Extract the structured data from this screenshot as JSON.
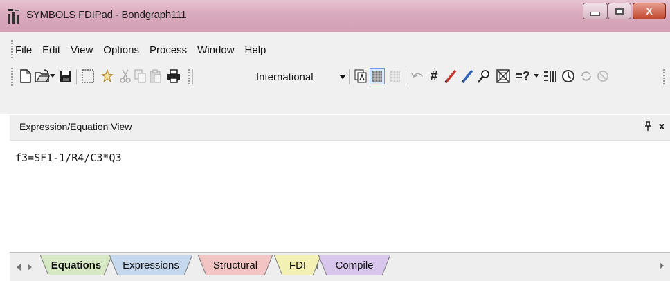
{
  "window": {
    "title": "SYMBOLS FDIPad - Bondgraph111",
    "close_glyph": "X"
  },
  "menu": {
    "items": [
      {
        "label": "File"
      },
      {
        "label": "Edit"
      },
      {
        "label": "View"
      },
      {
        "label": "Options"
      },
      {
        "label": "Process"
      },
      {
        "label": "Window"
      },
      {
        "label": "Help"
      }
    ]
  },
  "toolbar": {
    "icons": [
      "new-document-icon",
      "open-folder-icon",
      "dropdown-arrow-icon",
      "save-icon",
      "select-rect-icon",
      "sparkle-icon",
      "cut-icon",
      "copy-icon",
      "paste-icon",
      "print-icon",
      "font-icon",
      "grid-dense-icon",
      "grid-light-icon",
      "undo-icon",
      "hash-icon",
      "pen-red-icon",
      "pen-blue-icon",
      "zoom-icon",
      "model-icon",
      "help-query-icon",
      "list-icon",
      "clock-icon",
      "refresh-icon",
      "stop-icon"
    ],
    "language_select": "International"
  },
  "pane": {
    "title": "Expression/Equation View",
    "pin_glyph": "ᵖ",
    "close_glyph": "x"
  },
  "editor": {
    "content": "f3=SF1-1/R4/C3*Q3"
  },
  "tabs": [
    {
      "label": "Equations",
      "color": "#d6e8c4",
      "active": true
    },
    {
      "label": "Expressions",
      "color": "#c5d8ee",
      "active": false
    },
    {
      "label": "Structural",
      "color": "#f2c4c4",
      "active": false
    },
    {
      "label": "FDI",
      "color": "#f3f0b3",
      "active": false
    },
    {
      "label": "Compile",
      "color": "#d9c6ec",
      "active": false
    }
  ],
  "colors": {
    "titlebar": "#d9a9bd",
    "close_button": "#c2482f"
  }
}
